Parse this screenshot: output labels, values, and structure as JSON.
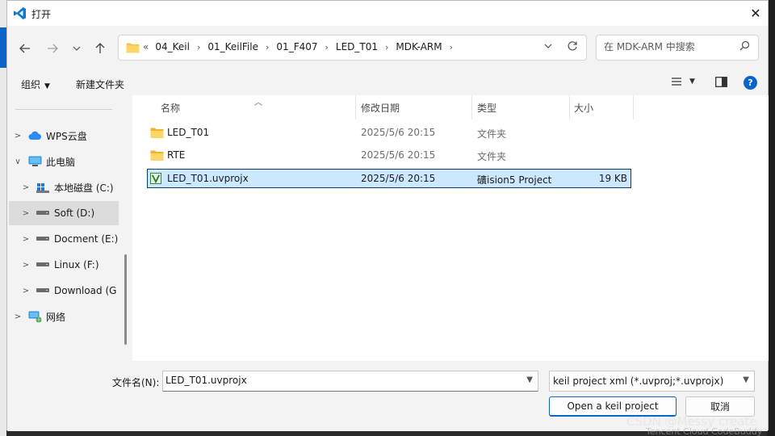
{
  "window": {
    "title": "打开",
    "close_glyph": "✕"
  },
  "nav": {
    "breadcrumb_lead": "«",
    "breadcrumb": [
      "04_Keil",
      "01_KeilFile",
      "01_F407",
      "LED_T01",
      "MDK-ARM"
    ],
    "search_placeholder": "在 MDK-ARM 中搜索"
  },
  "commands": {
    "organize": "组织",
    "new_folder": "新建文件夹",
    "help": "?"
  },
  "sidebar": {
    "items": [
      {
        "label": "WPS云盘",
        "icon": "cloud-icon",
        "expanded": false
      },
      {
        "label": "此电脑",
        "icon": "computer-icon",
        "expanded": true
      },
      {
        "label": "本地磁盘 (C:)",
        "icon": "windows-drive-icon",
        "expanded": false
      },
      {
        "label": "Soft (D:)",
        "icon": "drive-icon",
        "expanded": false,
        "selected": true
      },
      {
        "label": "Docment (E:)",
        "icon": "drive-icon",
        "expanded": false
      },
      {
        "label": "Linux (F:)",
        "icon": "drive-icon",
        "expanded": false
      },
      {
        "label": "Download (G",
        "icon": "drive-icon",
        "expanded": false
      },
      {
        "label": "网络",
        "icon": "network-icon",
        "expanded": false
      }
    ]
  },
  "columns": {
    "name": "名称",
    "date": "修改日期",
    "type": "类型",
    "size": "大小"
  },
  "files": [
    {
      "name": "LED_T01",
      "date": "2025/5/6 20:15",
      "type": "文件夹",
      "size": "",
      "icon": "folder-icon"
    },
    {
      "name": "RTE",
      "date": "2025/5/6 20:15",
      "type": "文件夹",
      "size": "",
      "icon": "folder-icon"
    },
    {
      "name": "LED_T01.uvprojx",
      "date": "2025/5/6 20:15",
      "type": "礦ision5 Project",
      "size": "19 KB",
      "icon": "uvision-project-icon",
      "selected": true
    }
  ],
  "bottom": {
    "filename_label": "文件名(N):",
    "filename_value": "LED_T01.uvprojx",
    "filter_value": "keil project xml (*.uvproj;*.uvprojx)",
    "open_label": "Open a keil project",
    "cancel_label": "取消"
  },
  "watermark": "CSDN @Messy create",
  "background_text": "Tencent Cloud CodeBuddy",
  "colors": {
    "accent": "#0a64c8",
    "selection": "#cce8ff",
    "folder": "#f8c54a"
  }
}
